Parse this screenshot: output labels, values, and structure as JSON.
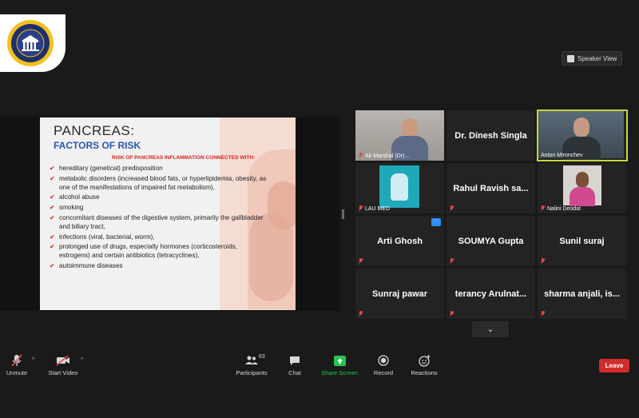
{
  "header": {
    "speaker_view_label": "Speaker View"
  },
  "slide": {
    "title": "PANCREAS:",
    "subtitle": "FACTORS OF RISK",
    "risk_heading": "RISK OF PANCREAS INFLAMMATION CONNECTED WITH:",
    "items": [
      "hereditary (genetical) predisposition",
      "metabolic disorders (increased blood fats, or hyperlipidemia, obesity, as one of the manifestations of impaired fat metabolism),",
      "alcohol abuse",
      "smoking",
      "concomitant diseases of the digestive system, primarily the gallbladder and biliary tract,",
      "infections (viral, bacterial, worm),",
      "prolonged use of drugs, especially hormones (corticosteroids, estrogens) and certain antibiotics (tetracyclines),",
      "autoimmune diseases"
    ]
  },
  "participants": [
    {
      "name": "Air Marshal (Dr)...",
      "label": "Air Marshal (Dr)..."
    },
    {
      "name": "Dr. Dinesh Singla"
    },
    {
      "name": "Anton Mironchev",
      "label": "Anton Mironchev"
    },
    {
      "name": "LAU MED",
      "label": "LAU MED"
    },
    {
      "name": "Rahul Ravish sa..."
    },
    {
      "name": "Nalini Deodat",
      "label": "Nalini Deodat"
    },
    {
      "name": "Arti Ghosh",
      "more": "···"
    },
    {
      "name": "SOUMYA Gupta"
    },
    {
      "name": "Sunil suraj"
    },
    {
      "name": "Sunraj pawar"
    },
    {
      "name": "terancy Arulnat..."
    },
    {
      "name": "sharma anjali, is..."
    }
  ],
  "pager_symbol": "⌄",
  "toolbar": {
    "unmute": "Unmute",
    "start_video": "Start Video",
    "participants": "Participants",
    "participants_count": "63",
    "chat": "Chat",
    "share_screen": "Share Screen",
    "record": "Record",
    "reactions": "Reactions",
    "leave": "Leave"
  },
  "colors": {
    "accent_green": "#23c552",
    "leave_red": "#d12b2b",
    "active_border": "#c8d63a",
    "slide_blue": "#2a56b8",
    "slide_red": "#d92020"
  }
}
